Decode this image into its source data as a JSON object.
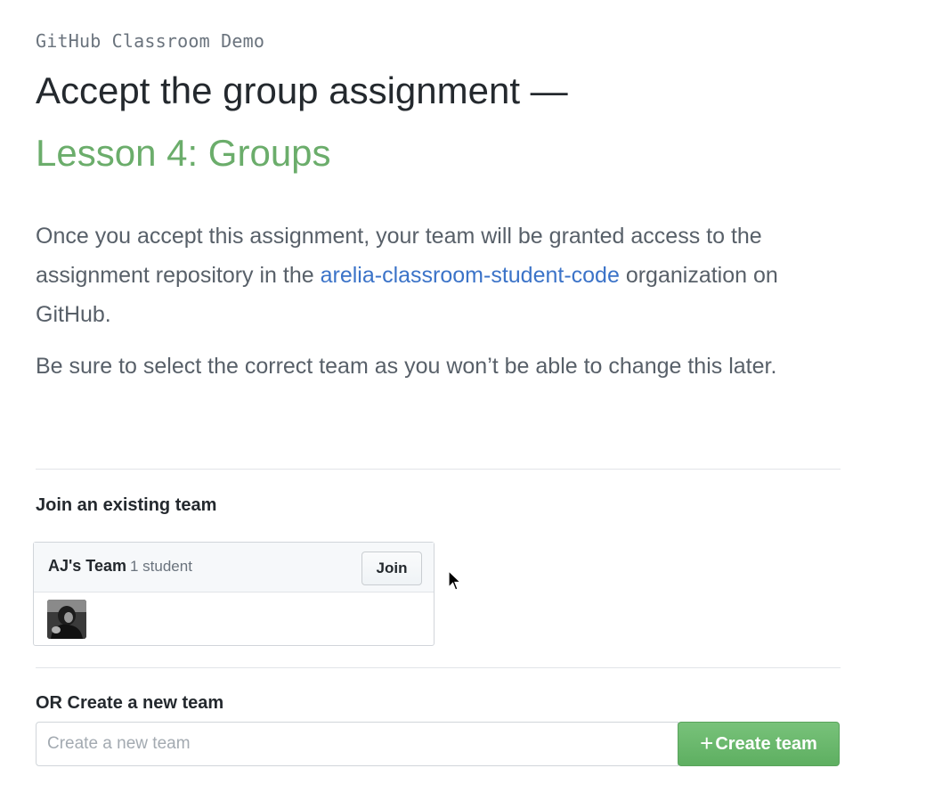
{
  "header": {
    "classroom_name": "GitHub Classroom Demo",
    "heading": "Accept the group assignment —",
    "assignment_title": "Lesson 4: Groups"
  },
  "intro": {
    "paragraph1_before": "Once you accept this assignment, your team will be granted access to the assignment repository in the ",
    "org_link": "arelia-classroom-student-code",
    "paragraph1_after": " organization on GitHub.",
    "paragraph2": "Be sure to select the correct team as you won’t be able to change this later."
  },
  "join_section": {
    "title": "Join an existing team",
    "teams": [
      {
        "name": "AJ's Team",
        "member_count": "1 student",
        "join_label": "Join"
      }
    ]
  },
  "create_section": {
    "title": "OR Create a new team",
    "input_placeholder": "Create a new team",
    "input_value": "",
    "button_label": "Create team",
    "button_icon": "plus-icon"
  },
  "colors": {
    "assignment_title": "#6bad6b",
    "link": "#3b73c8",
    "create_button": "#6cb96e"
  }
}
